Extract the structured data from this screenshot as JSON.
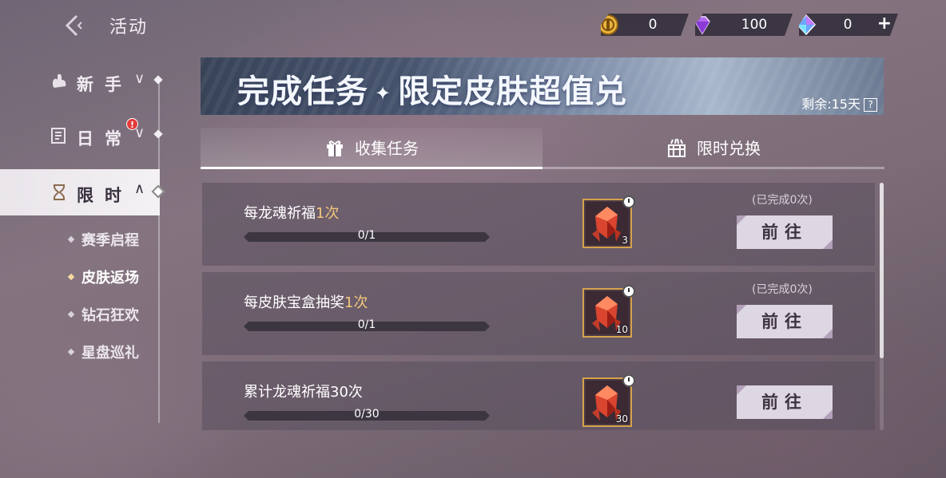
{
  "header": {
    "title": "活动",
    "currencies": [
      {
        "icon": "gold-coin-icon",
        "value": "0"
      },
      {
        "icon": "purple-diamond-icon",
        "value": "100"
      },
      {
        "icon": "blue-crystal-icon",
        "value": "0"
      }
    ],
    "plus_label": "+"
  },
  "sidebar": {
    "categories": [
      {
        "label": "新手",
        "icon": "duck-icon",
        "chevron": "∨"
      },
      {
        "label": "日常",
        "icon": "checklist-icon",
        "chevron": "∨",
        "badge": "!"
      },
      {
        "label": "限时",
        "icon": "hourglass-icon",
        "chevron": "∧"
      }
    ],
    "sub_items": [
      "赛季启程",
      "皮肤返场",
      "钻石狂欢",
      "星盘巡礼"
    ],
    "active_sub": "皮肤返场"
  },
  "banner": {
    "title_left": "完成任务",
    "title_sep": "✦",
    "title_right": "限定皮肤超值兑",
    "remain_label": "剩余:",
    "remain_value": "15天",
    "help": "?"
  },
  "tabs": [
    {
      "label": "收集任务",
      "icon": "gift-icon",
      "active": true
    },
    {
      "label": "限时兑换",
      "icon": "gift-box-icon",
      "active": false
    }
  ],
  "tasks": [
    {
      "name_prefix": "每龙魂祈福",
      "name_highlight": "1次",
      "progress": "0/1",
      "progress_fraction": 0,
      "reward_qty": "3",
      "done_text": "(已完成0次)",
      "button": "前往"
    },
    {
      "name_prefix": "每皮肤宝盒抽奖",
      "name_highlight": "1次",
      "progress": "0/1",
      "progress_fraction": 0,
      "reward_qty": "10",
      "done_text": "(已完成0次)",
      "button": "前往"
    },
    {
      "name_prefix": "累计龙魂祈福30次",
      "name_highlight": "",
      "progress": "0/30",
      "progress_fraction": 0,
      "reward_qty": "30",
      "done_text": "",
      "button": "前往"
    }
  ],
  "colors": {
    "highlight": "#f3c77b",
    "reward_border": "#d6a34c",
    "badge": "#e23b3b"
  }
}
